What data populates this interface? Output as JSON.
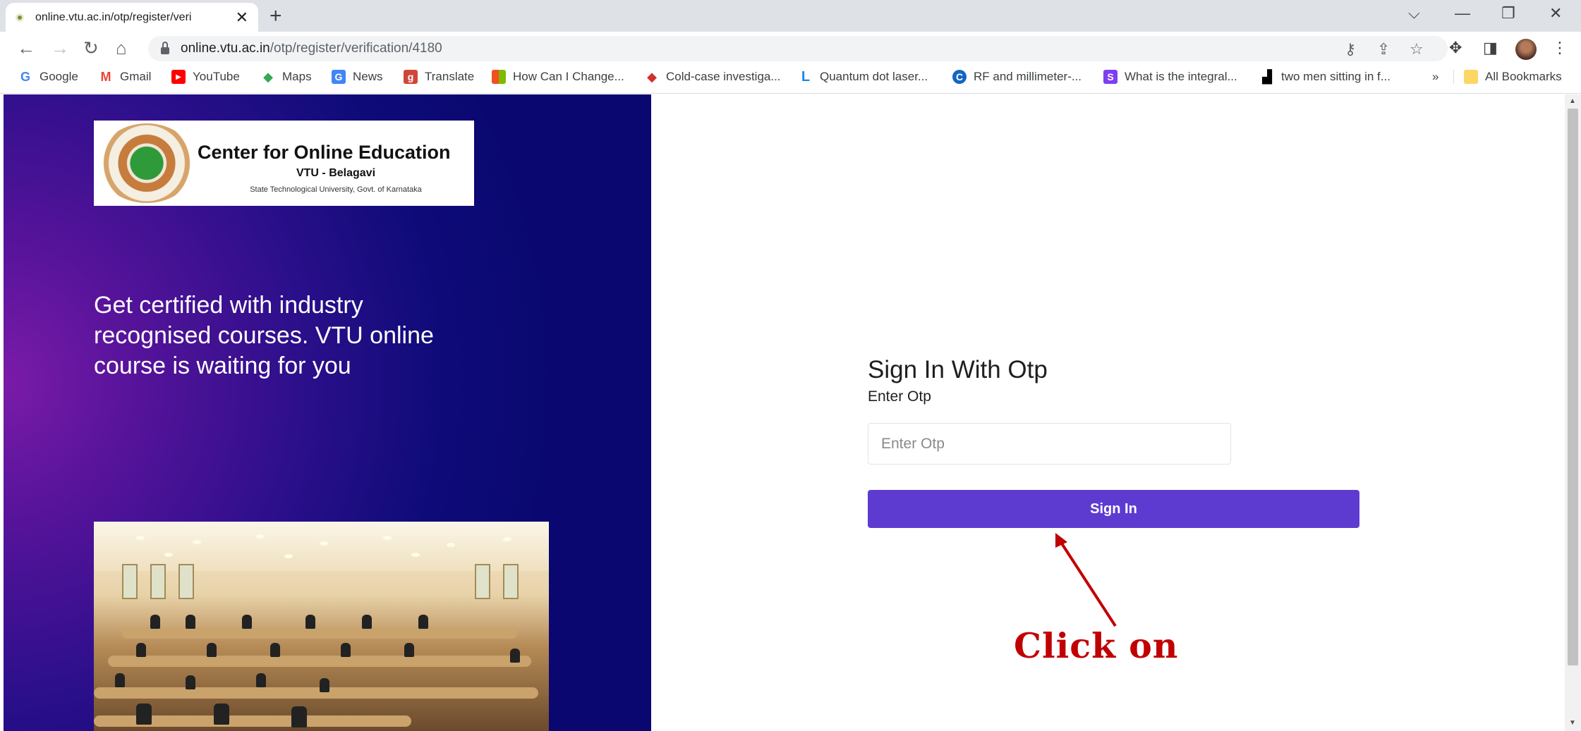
{
  "browser": {
    "tab_title": "online.vtu.ac.in/otp/register/veri",
    "tab_close": "✕",
    "new_tab": "+",
    "url_host": "online.vtu.ac.in",
    "url_path": "/otp/register/verification/4180",
    "window_controls": {
      "tab_search": "⌵",
      "minimize": "—",
      "restore": "❐",
      "close": "✕"
    },
    "bookmarks": [
      {
        "label": "Google",
        "icon": "G",
        "color": "#4285f4"
      },
      {
        "label": "Gmail",
        "icon": "M",
        "color": "#ea4335"
      },
      {
        "label": "YouTube",
        "icon": "▶",
        "color": "#ff0000"
      },
      {
        "label": "Maps",
        "icon": "◆",
        "color": "#34a853"
      },
      {
        "label": "News",
        "icon": "G",
        "color": "#4285f4"
      },
      {
        "label": "Translate",
        "icon": "g",
        "color": "#d0463a"
      },
      {
        "label": "How Can I Change...",
        "icon": "■",
        "color": "#f25022"
      },
      {
        "label": "Cold-case investiga...",
        "icon": "◆",
        "color": "#d32f2f"
      },
      {
        "label": "Quantum dot laser...",
        "icon": "L",
        "color": "#1e88e5"
      },
      {
        "label": "RF and millimeter-...",
        "icon": "C",
        "color": "#1565c0"
      },
      {
        "label": "What is the integral...",
        "icon": "S",
        "color": "#7e3ff2"
      },
      {
        "label": "two men sitting in f...",
        "icon": "▟",
        "color": "#000000"
      }
    ],
    "bookmarks_overflow": "»",
    "all_bookmarks": "All Bookmarks"
  },
  "left_panel": {
    "logo_title": "Center for Online Education",
    "logo_subtitle": "VTU - Belagavi",
    "logo_caption": "State Technological University, Govt. of Karnataka",
    "tagline": "Get certified with industry recognised courses. VTU online course is waiting for you"
  },
  "form": {
    "title": "Sign In With Otp",
    "label": "Enter Otp",
    "otp_placeholder": "Enter Otp",
    "otp_value": "",
    "submit_label": "Sign In"
  },
  "annotation": {
    "text": "Click on",
    "color": "#c00000"
  },
  "colors": {
    "primary_button": "#5e3bd0",
    "panel_gradient_start": "#7a1ba8",
    "panel_gradient_end": "#0a0870"
  }
}
